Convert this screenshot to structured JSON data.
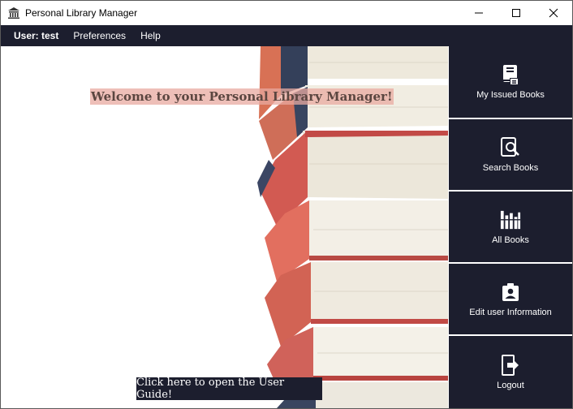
{
  "window": {
    "title": "Personal Library Manager"
  },
  "menu": {
    "user": "User: test",
    "preferences": "Preferences",
    "help": "Help"
  },
  "main": {
    "welcome": "Welcome to your Personal Library Manager!",
    "guide_button": "Click here to open the User Guide!"
  },
  "sidebar": {
    "items": [
      {
        "label": "My Issued Books",
        "icon": "issued-books-icon"
      },
      {
        "label": "Search Books",
        "icon": "search-book-icon"
      },
      {
        "label": "All Books",
        "icon": "bookshelf-icon"
      },
      {
        "label": "Edit user Information",
        "icon": "user-badge-icon"
      },
      {
        "label": "Logout",
        "icon": "logout-icon"
      }
    ]
  },
  "colors": {
    "accent": "#1c1e2e",
    "welcome_highlight": "#e8aaa0"
  }
}
